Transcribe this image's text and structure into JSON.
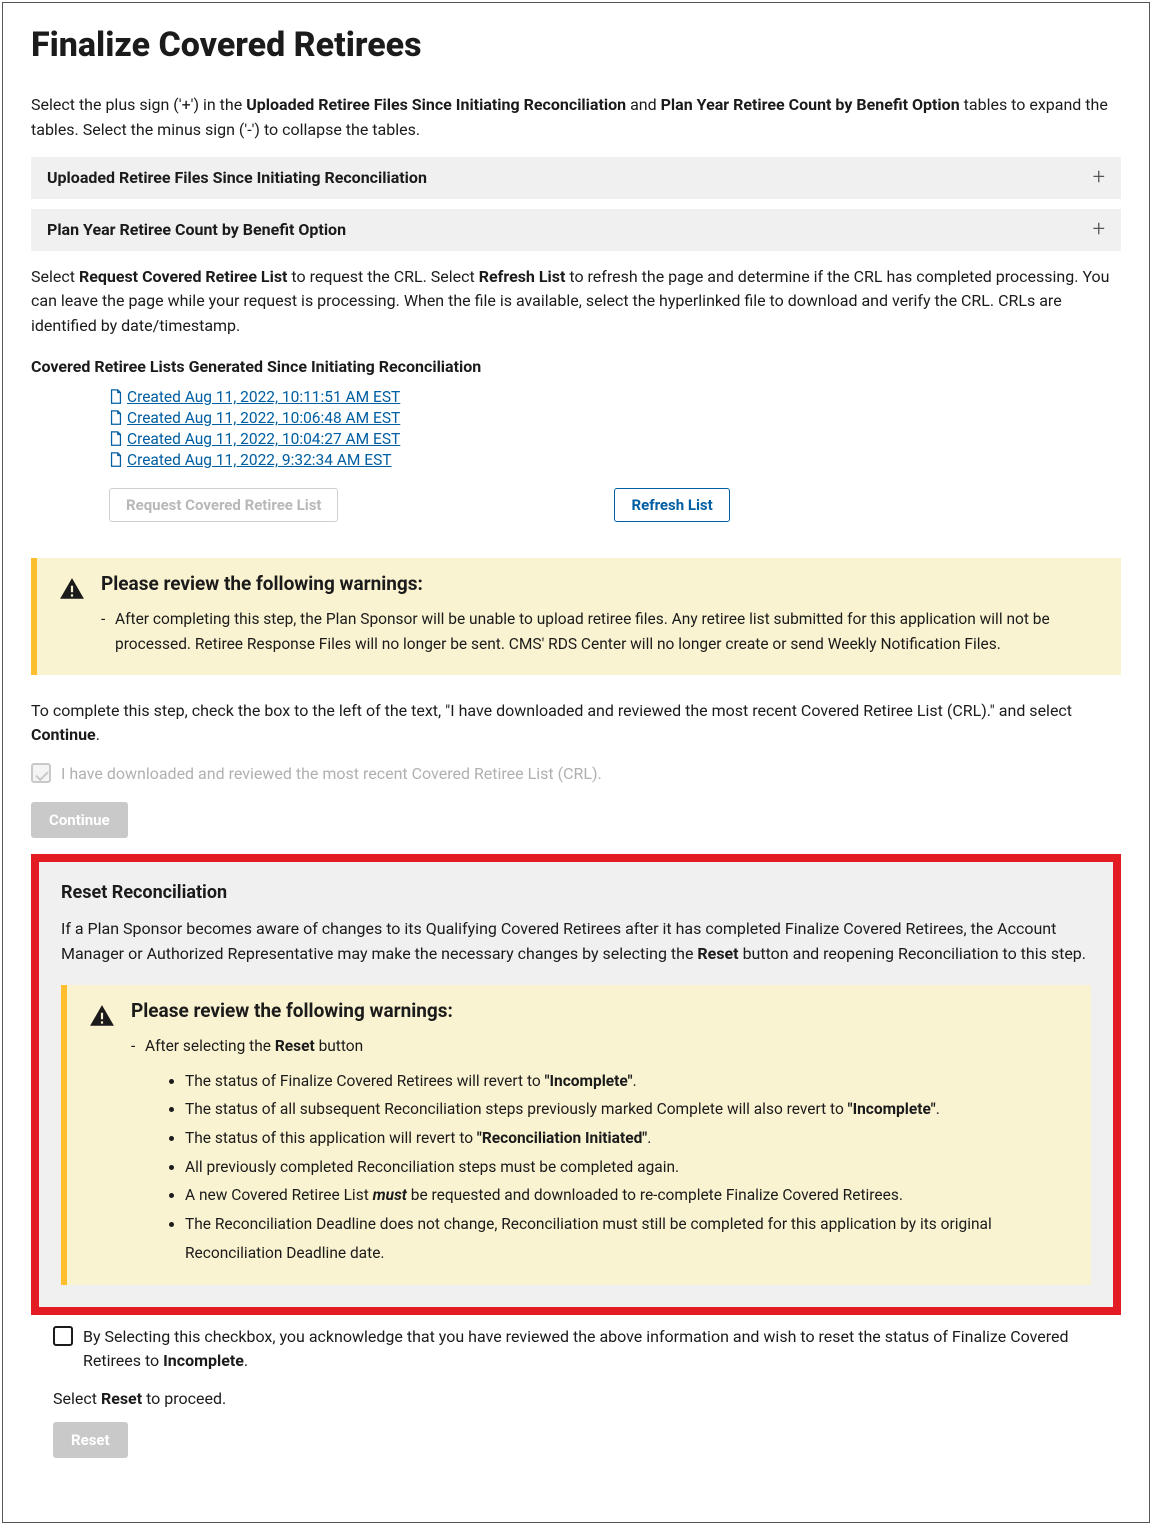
{
  "page_title": "Finalize Covered Retirees",
  "intro": {
    "part1": "Select the plus sign ('+') in the ",
    "b1": "Uploaded Retiree Files Since Initiating Reconciliation",
    "mid": " and ",
    "b2": "Plan Year Retiree Count by Benefit Option",
    "part2": " tables to expand the tables. Select the minus sign ('-') to collapse the tables."
  },
  "accordion1": "Uploaded Retiree Files Since Initiating Reconciliation",
  "accordion2": "Plan Year Retiree Count by Benefit Option",
  "crl_intro": {
    "p1": "Select ",
    "b1": "Request Covered Retiree List",
    "p2": " to request the CRL. Select ",
    "b2": "Refresh List",
    "p3": " to refresh the page and determine if the CRL has completed processing. You can leave the page while your request is processing. When the file is available, select the hyperlinked file to download and verify the CRL. CRLs are identified by date/timestamp."
  },
  "crl_heading": "Covered Retiree Lists Generated Since Initiating Reconciliation",
  "crl_files": [
    " Created Aug 11, 2022, 10:11:51 AM EST",
    " Created Aug 11, 2022, 10:06:48 AM EST",
    " Created Aug 11, 2022, 10:04:27 AM EST",
    " Created Aug 11, 2022, 9:32:34 AM EST"
  ],
  "btn_request": "Request Covered Retiree List",
  "btn_refresh": "Refresh List",
  "warning1_heading": "Please review the following warnings:",
  "warning1_text": "After completing this step, the Plan Sponsor will be unable to upload retiree files. Any retiree list submitted for this application will not be processed. Retiree Response Files will no longer be sent. CMS' RDS Center will no longer create or send Weekly Notification Files.",
  "complete_instr": {
    "p1": "To complete this step, check the box to the left of the text, \"I have downloaded and reviewed the most recent Covered Retiree List (CRL).\" and select ",
    "b1": "Continue",
    "p2": "."
  },
  "checkbox_label": "I have downloaded and reviewed the most recent Covered Retiree List (CRL).",
  "btn_continue": "Continue",
  "reset": {
    "heading": "Reset Reconciliation",
    "body": {
      "p1": "If a Plan Sponsor becomes aware of changes to its Qualifying Covered Retirees after it has completed Finalize Covered Retirees, the Account Manager or Authorized Representative may make the necessary changes by selecting the ",
      "b1": "Reset",
      "p2": " button and reopening Reconciliation to this step."
    },
    "warning_heading": "Please review the following warnings:",
    "warning_lead": {
      "p1": "After selecting the ",
      "b1": "Reset",
      "p2": " button"
    },
    "bullets": {
      "b0p1": "The status of Finalize Covered Retirees will revert to ",
      "b0b": "\"Incomplete\"",
      "b0p2": ".",
      "b1p1": "The status of all subsequent Reconciliation steps previously marked Complete will also revert to ",
      "b1b": "\"Incomplete\"",
      "b1p2": ".",
      "b2p1": "The status of this application will revert to ",
      "b2b": "\"Reconciliation Initiated\"",
      "b2p2": ".",
      "b3": "All previously completed Reconciliation steps must be completed again.",
      "b4p1": "A new Covered Retiree List ",
      "b4b": "must",
      "b4p2": " be requested and downloaded to re-complete Finalize Covered Retirees.",
      "b5": "The Reconciliation Deadline does not change, Reconciliation must still be completed for this application by its original Reconciliation Deadline date."
    },
    "ack": {
      "p1": "By Selecting this checkbox, you acknowledge that you have reviewed the above information and wish to reset the status of Finalize Covered Retirees to ",
      "b1": "Incomplete",
      "p2": "."
    },
    "proceed": {
      "p1": "Select ",
      "b1": "Reset",
      "p2": " to proceed."
    },
    "btn_reset": "Reset"
  }
}
